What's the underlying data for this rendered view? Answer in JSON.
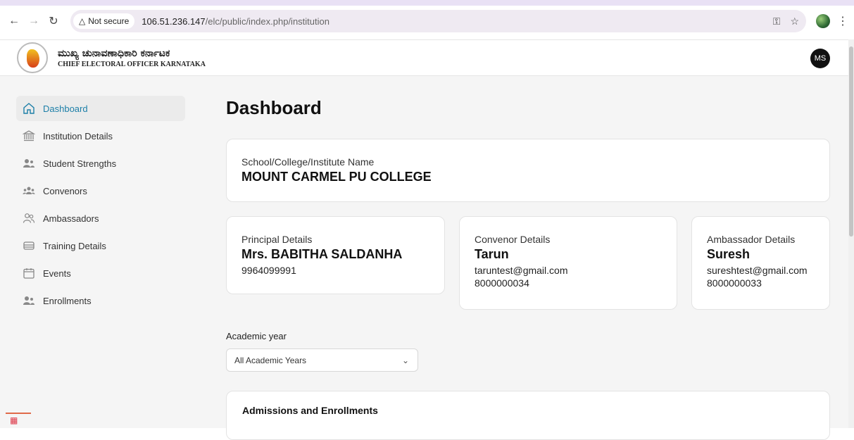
{
  "browser": {
    "security_label": "Not secure",
    "url_host": "106.51.236.147",
    "url_path": "/elc/public/index.php/institution"
  },
  "header": {
    "brand_kannada": "ಮುಖ್ಯ ಚುನಾವಣಾಧಿಕಾರಿ ಕರ್ನಾಟಕ",
    "brand_english": "CHIEF ELECTORAL OFFICER KARNATAKA",
    "avatar_initials": "MS"
  },
  "sidebar": {
    "items": [
      {
        "label": "Dashboard",
        "icon": "home-icon",
        "active": true
      },
      {
        "label": "Institution Details",
        "icon": "institution-icon"
      },
      {
        "label": "Student Strengths",
        "icon": "users-icon"
      },
      {
        "label": "Convenors",
        "icon": "group-icon"
      },
      {
        "label": "Ambassadors",
        "icon": "people-outline-icon"
      },
      {
        "label": "Training Details",
        "icon": "card-icon"
      },
      {
        "label": "Events",
        "icon": "calendar-icon"
      },
      {
        "label": "Enrollments",
        "icon": "users-icon"
      }
    ]
  },
  "main": {
    "title": "Dashboard",
    "institution": {
      "label": "School/College/Institute Name",
      "name": "MOUNT CARMEL PU COLLEGE"
    },
    "principal": {
      "label": "Principal Details",
      "name": "Mrs. BABITHA SALDANHA",
      "phone": "9964099991"
    },
    "convenor": {
      "label": "Convenor Details",
      "name": "Tarun",
      "email": "taruntest@gmail.com",
      "phone": "8000000034"
    },
    "ambassador": {
      "label": "Ambassador Details",
      "name": "Suresh",
      "email": "sureshtest@gmail.com",
      "phone": "8000000033"
    },
    "academic_year": {
      "label": "Academic year",
      "selected": "All Academic Years"
    },
    "admissions": {
      "title": "Admissions and Enrollments"
    }
  },
  "colors": {
    "accent": "#1d7fa8",
    "sidebar_bg": "#f5f5f5"
  }
}
